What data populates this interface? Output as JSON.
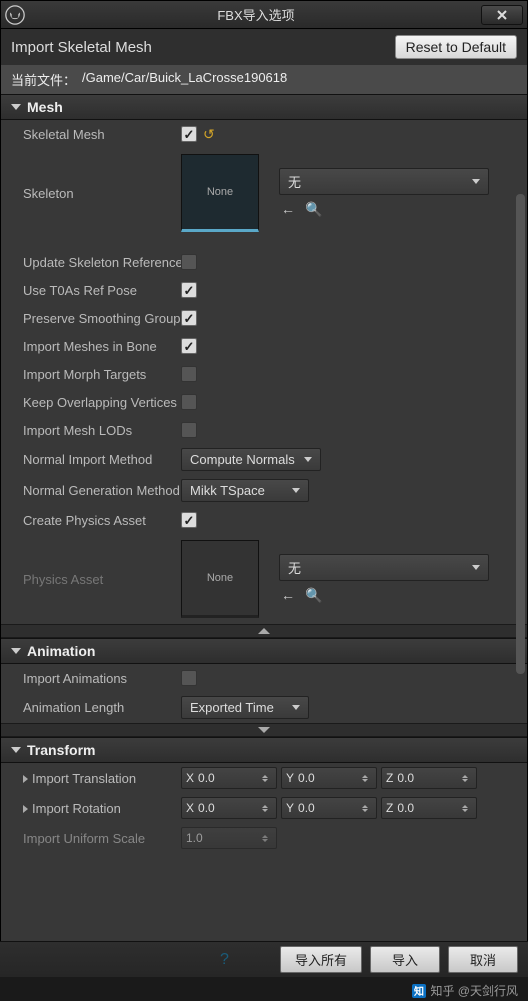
{
  "window": {
    "title": "FBX导入选项"
  },
  "header": {
    "title": "Import Skeletal Mesh",
    "reset_btn": "Reset to Default"
  },
  "path": {
    "label": "当前文件：",
    "value": "/Game/Car/Buick_LaCrosse190618"
  },
  "sections": {
    "mesh": {
      "title": "Mesh",
      "skeletal_mesh": "Skeletal Mesh",
      "skeleton": "Skeleton",
      "skeleton_thumb": "None",
      "skeleton_dd": "无",
      "update_skel": "Update Skeleton Reference",
      "use_t0": "Use T0As Ref Pose",
      "preserve_smooth": "Preserve Smoothing Groups",
      "import_bone": "Import Meshes in Bone",
      "import_morph": "Import Morph Targets",
      "keep_overlap": "Keep Overlapping Vertices",
      "import_lods": "Import Mesh LODs",
      "normal_method": "Normal Import Method",
      "normal_method_val": "Compute Normals",
      "normal_gen": "Normal Generation Method",
      "normal_gen_val": "Mikk TSpace",
      "create_physics": "Create Physics Asset",
      "physics_asset": "Physics Asset",
      "physics_thumb": "None",
      "physics_dd": "无"
    },
    "animation": {
      "title": "Animation",
      "import_anim": "Import Animations",
      "anim_length": "Animation Length",
      "anim_length_val": "Exported Time"
    },
    "transform": {
      "title": "Transform",
      "import_trans": "Import Translation",
      "import_rot": "Import Rotation",
      "import_scale": "Import Uniform Scale",
      "x": "X",
      "y": "Y",
      "z": "Z",
      "zero": "0.0",
      "one": "1.0"
    }
  },
  "footer": {
    "import_all": "导入所有",
    "import": "导入",
    "cancel": "取消"
  },
  "watermark": "知乎 @天剑行风"
}
